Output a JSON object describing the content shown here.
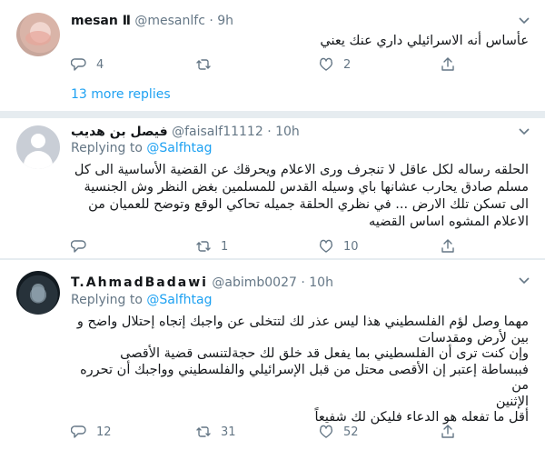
{
  "tweets": [
    {
      "name": "mesan Ⅱ",
      "handle": "@mesanlfc",
      "dot": "·",
      "time": "9h",
      "text_lines": [
        "عأساس أنه الاسرائيلي داري عنك يعني"
      ],
      "replies": "4",
      "retweets": "",
      "likes": "2",
      "more_replies": "13 more replies"
    },
    {
      "name": "فيصل بن هديب",
      "handle": "@faisalf11112",
      "dot": "·",
      "time": "10h",
      "replying_prefix": "Replying to",
      "replying_mention": "@Salfhtag",
      "text_lines": [
        "الحلقه رساله لكل عاقل لا تنجرف ورى الاعلام ويحرقك عن القضية الأساسية الى كل",
        "مسلم صادق يحارب عشانها باي وسيله القدس للمسلمين بغض النظر وش الجنسية",
        "الى تسكن تلك الارض ... في نظري الحلقة جميله تحاكي الوقع وتوضح للعميان من",
        "الاعلام المشوه اساس القضيه"
      ],
      "replies": "",
      "retweets": "1",
      "likes": "10"
    },
    {
      "name": "T.AhmadBadawi",
      "handle": "@abimb0027",
      "dot": "·",
      "time": "10h",
      "replying_prefix": "Replying to",
      "replying_mention": "@Salfhtag",
      "text_lines": [
        "مهما وصل لؤم الفلسطيني هذا ليس عذر لك لتتخلى عن واجبك إتجاه إحتلال واضح و",
        "بين لأرض ومقدسات",
        "وإن كنت ترى أن الفلسطيني بما يفعل قد خلق لك حجةلتنسى قضية الأقصى",
        "فببساطة إعتبر إن الأقصى محتل من قبل الإسرائيلي والفلسطيني وواجبك أن تحرره من",
        "الإثنين",
        "أقل ما تفعله هو الدعاء فليكن لك شفيعاً"
      ],
      "replies": "12",
      "retweets": "31",
      "likes": "52"
    }
  ]
}
